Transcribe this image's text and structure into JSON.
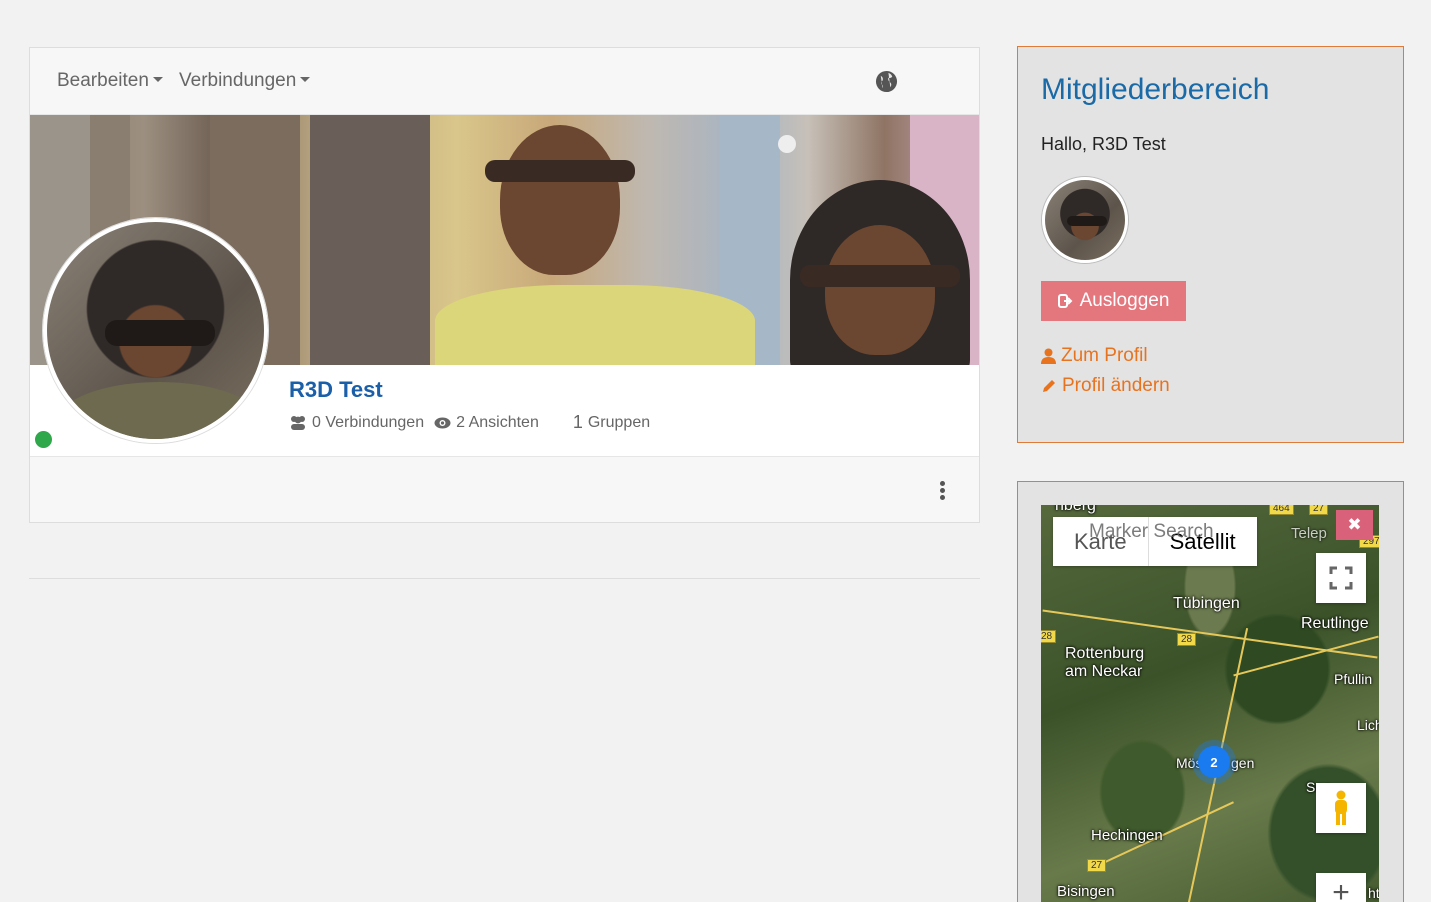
{
  "profile_nav": {
    "edit_label": "Bearbeiten",
    "connections_label": "Verbindungen"
  },
  "profile": {
    "name": "R3D Test",
    "connections": "0 Verbindungen",
    "views": "2 Ansichten",
    "groups_count": "1",
    "groups_label": "Gruppen",
    "online_color": "#2ea84a"
  },
  "member_area": {
    "title": "Mitgliederbereich",
    "greeting": "Hallo, R3D Test",
    "logout_label": "Ausloggen",
    "profile_link": "Zum Profil",
    "edit_profile_link": "Profil ändern",
    "accent_color": "#e8731f",
    "logout_color": "#e4767e"
  },
  "map": {
    "map_type_map": "Karte",
    "map_type_satellite": "Satellit",
    "marker_search_placeholder": "Marker Search",
    "cluster_count": "2",
    "towns": {
      "top": "nberg",
      "tuebingen": "Tübingen",
      "reutlingen": "Reutlinge",
      "rottenburg_1": "Rottenburg",
      "rottenburg_2": "am Neckar",
      "pfullingen": "Pfullin",
      "lichtenstein": "Lich",
      "moessingen_a": "Mös",
      "moessingen_b": "gen",
      "sonnenbuehl": "Son",
      "hechingen": "Hechingen",
      "bisingen": "Bisingen",
      "extra": "ht",
      "telep": "Telep"
    },
    "shields": {
      "s464": "464",
      "s27a": "27",
      "s297": "297",
      "s28a": "28",
      "s28b": "28",
      "s27b": "27"
    }
  }
}
